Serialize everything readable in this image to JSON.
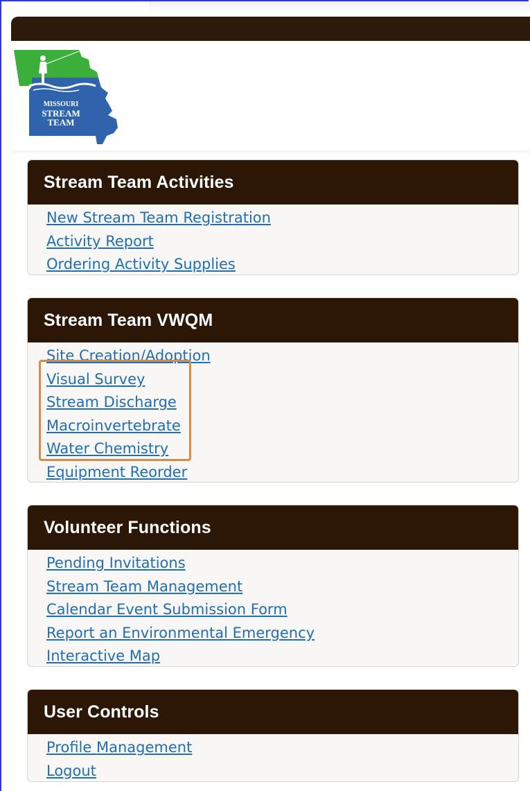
{
  "logo": {
    "line1": "MISSOURI",
    "line2": "STREAM",
    "line3": "TEAM",
    "icon": "missouri-stream-team-logo-icon"
  },
  "panels": {
    "activities": {
      "title": "Stream Team Activities",
      "links": [
        "New Stream Team Registration",
        "Activity Report",
        "Ordering Activity Supplies"
      ]
    },
    "vwqm": {
      "title": "Stream Team VWQM",
      "links": [
        "Site Creation/Adoption",
        "Visual Survey",
        "Stream Discharge",
        "Macroinvertebrate",
        "Water Chemistry",
        "Equipment Reorder"
      ]
    },
    "volunteer": {
      "title": "Volunteer Functions",
      "links": [
        "Pending Invitations",
        "Stream Team Management",
        "Calendar Event Submission Form",
        "Report an Environmental Emergency",
        "Interactive Map"
      ]
    },
    "user": {
      "title": "User Controls",
      "links": [
        "Profile Management",
        "Logout"
      ]
    }
  },
  "colors": {
    "header_bg": "#2c1706",
    "link": "#1f6fb5",
    "highlight": "#d98a47",
    "logo_green": "#3cae3a",
    "logo_blue": "#2f64ad"
  }
}
